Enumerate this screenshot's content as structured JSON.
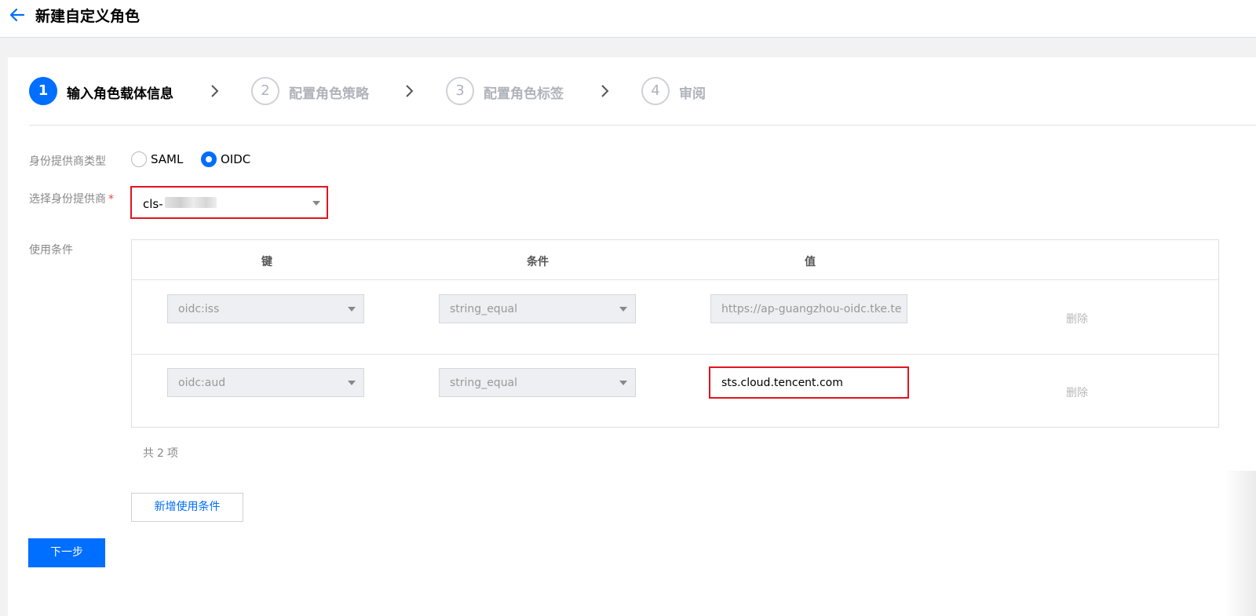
{
  "header": {
    "title": "新建自定义角色"
  },
  "steps": [
    {
      "num": "1",
      "label": "输入角色载体信息"
    },
    {
      "num": "2",
      "label": "配置角色策略"
    },
    {
      "num": "3",
      "label": "配置角色标签"
    },
    {
      "num": "4",
      "label": "审阅"
    }
  ],
  "form": {
    "provider_type_label": "身份提供商类型",
    "provider_type_options": [
      "SAML",
      "OIDC"
    ],
    "provider_type_selected": "OIDC",
    "provider_label": "选择身份提供商",
    "required_mark": "*",
    "provider_value": "cls-",
    "conditions_label": "使用条件"
  },
  "table": {
    "headers": {
      "key": "键",
      "condition": "条件",
      "value": "值"
    },
    "rows": [
      {
        "key": "oidc:iss",
        "condition": "string_equal",
        "value": "https://ap-guangzhou-oidc.tke.te",
        "action": "删除"
      },
      {
        "key": "oidc:aud",
        "condition": "string_equal",
        "value": "sts.cloud.tencent.com",
        "action": "删除"
      }
    ],
    "total_prefix": "共",
    "total_count": "2",
    "total_suffix": "项"
  },
  "buttons": {
    "add_condition": "新增使用条件",
    "next": "下一步"
  },
  "colors": {
    "primary": "#006eff",
    "highlight": "#e0141e"
  }
}
